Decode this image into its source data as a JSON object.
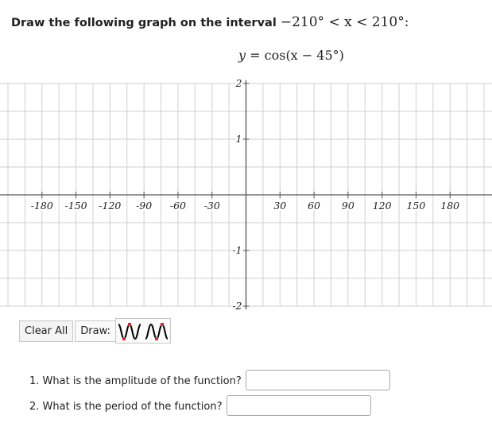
{
  "prompt": {
    "text": "Draw the following graph on the interval",
    "interval": "−210° < x < 210°:"
  },
  "formula": {
    "lhs": "y",
    "rhs": "= cos(x − 45°)"
  },
  "graph": {
    "x_ticks": [
      "-180",
      "-150",
      "-120",
      "-90",
      "-60",
      "-30",
      "30",
      "60",
      "90",
      "120",
      "150",
      "180"
    ],
    "x_tick_values": [
      -180,
      -150,
      -120,
      -90,
      -60,
      -30,
      30,
      60,
      90,
      120,
      150,
      180
    ],
    "y_ticks": [
      "2",
      "1",
      "-1",
      "-2"
    ],
    "y_tick_values": [
      2,
      1,
      -1,
      -2
    ],
    "x_range": [
      -210,
      210
    ],
    "y_range": [
      -2,
      2
    ],
    "x_grid_step": 15,
    "y_grid_step": 0.5,
    "grid": true
  },
  "toolbar": {
    "clear_label": "Clear All",
    "draw_label": "Draw:",
    "tools": [
      "sine-wave-tool-icon",
      "cosine-wave-tool-icon"
    ]
  },
  "questions": [
    {
      "label": "1. What is the amplitude of the function?",
      "value": ""
    },
    {
      "label": "2. What is the period of the function?",
      "value": ""
    }
  ],
  "colors": {
    "grid": "#cfcfcf",
    "axis": "#555555",
    "tool_point": "#d9262b"
  }
}
